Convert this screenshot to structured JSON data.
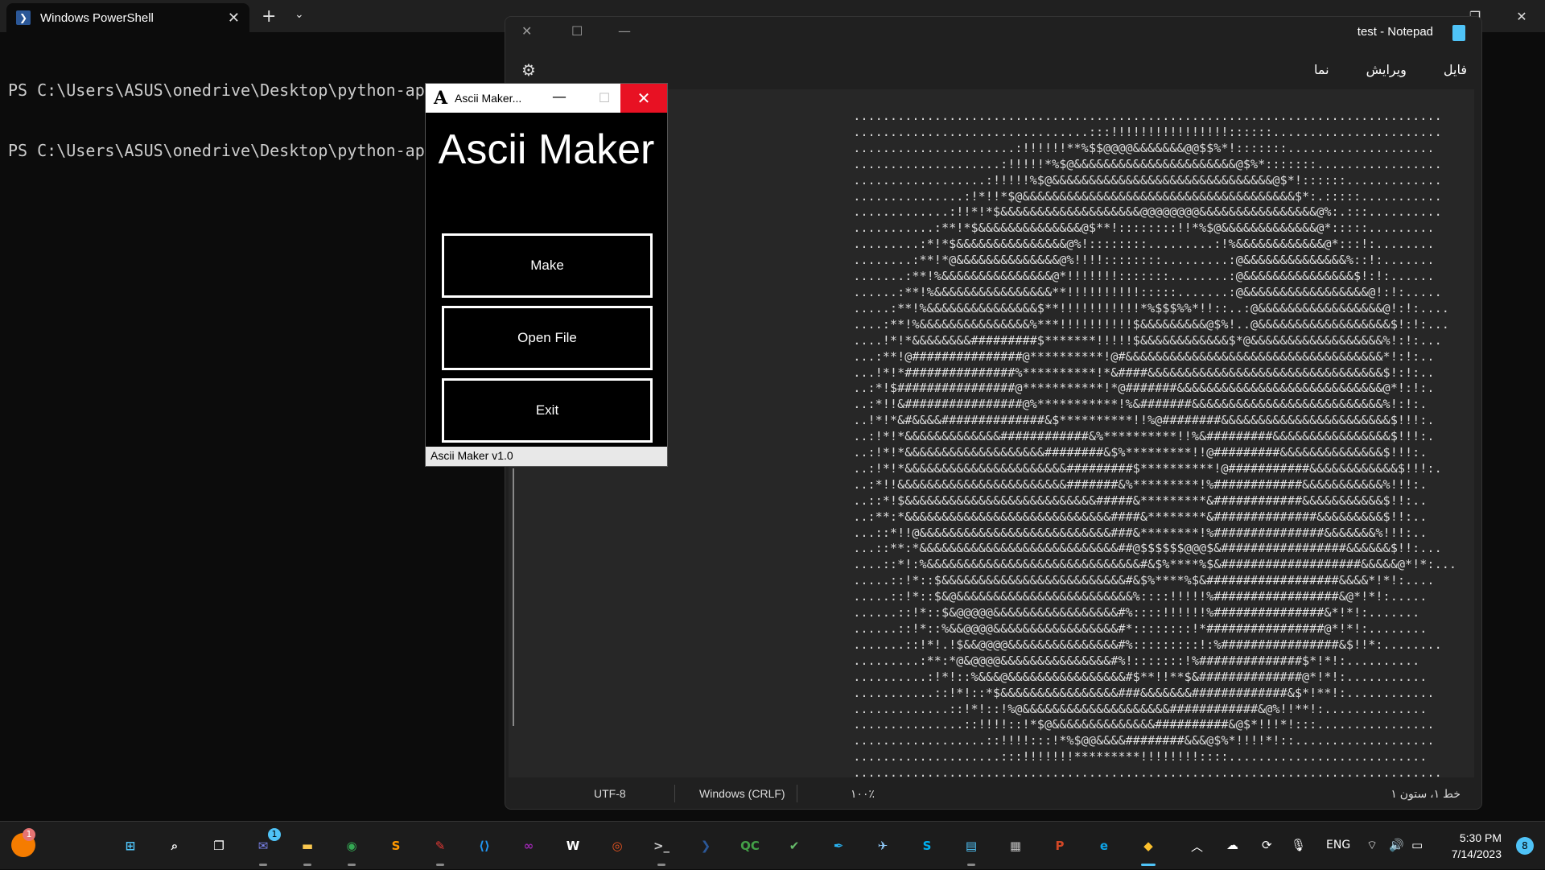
{
  "terminal": {
    "tab_title": "Windows PowerShell",
    "lines": [
      "PS C:\\Users\\ASUS\\onedrive\\Desktop\\python-app\\ascii-m",
      "PS C:\\Users\\ASUS\\onedrive\\Desktop\\python-app\\ascii-m"
    ]
  },
  "notepad": {
    "title": "test - Notepad",
    "menu": [
      "فایل",
      "ویرایش",
      "نما"
    ],
    "status": {
      "position": "خط ۱، ستون ۱",
      "zoom": "۱۰۰٪",
      "line_ending": "Windows (CRLF)",
      "encoding": "UTF-8"
    },
    "ascii_art": [
      "................................................................................",
      "................................:::!!!!!!!!!!!!!!!!::::::.......................",
      "......................:!!!!!!**%$$@@@@&&&&&&&@@$$%*!:::::::....................",
      "....................:!!!!!*%$@&&&&&&&&&&&&&&&&&&&&&&@$%*:::::::.................",
      "..................:!!!!!%$@&&&&&&&&&&&&&&&&&&&&&&&&&&&&&&@$*!::::::.............",
      "...............:!*!!*$@&&&&&&&&&&&&&&&&&&&&&&&&&&&&&&&&&&&&&$*:.:::::...........",
      ".............:!!*!*$&&&&&&&&&&&&&&&&&&&@@@@@@@@&&&&&&&&&&&&&&&&@%:.:::..........",
      "...........:**!*$&&&&&&&&&&&&&&@$**!::::::::!!*%$@&&&&&&&&&&&&&@*:::::.........",
      ".........:*!*$&&&&&&&&&&&&&&&@%!::::::::.........:!%&&&&&&&&&&&&@*:::!:........",
      "........:**!*@&&&&&&&&&&&&&&@%!!!!::::::::.........:@&&&&&&&&&&&&&&%::!:.......",
      ".......:**!%&&&&&&&&&&&&&&&@*!!!!!!!:::::::........:@&&&&&&&&&&&&&&&$!:!:......",
      "......:**!%&&&&&&&&&&&&&&&&**!!!!!!!!!!:::::.......:@&&&&&&&&&&&&&&&&&@!:!:.....",
      ".....:**!%&&&&&&&&&&&&&&&$**!!!!!!!!!!!*%$$$%%*!!::..:@&&&&&&&&&&&&&&&&&@!:!:....",
      "....:**!%&&&&&&&&&&&&&&&%***!!!!!!!!!!$&&&&&&&&&@$%!..@&&&&&&&&&&&&&&&&&&$!:!:...",
      "....!*!*&&&&&&&&#########$*******!!!!!$&&&&&&&&&&&&$*@&&&&&&&&&&&&&&&&&&%!:!:...",
      "...:**!@###############@**********!@#&&&&&&&&&&&&&&&&&&&&&&&&&&&&&&&&&&&*!:!:..",
      "...!*!*###############%**********!*&####&&&&&&&&&&&&&&&&&&&&&&&&&&&&&&&&$!:!:..",
      "..:*!$################@***********!*@#######&&&&&&&&&&&&&&&&&&&&&&&&&&&&@*!:!:.",
      "..:*!!&################@%***********!%&#######&&&&&&&&&&&&&&&&&&&&&&&&&&%!:!:.",
      "..!*!*&#&&&&##############&$**********!!%@########&&&&&&&&&&&&&&&&&&&&&&&$!!!:.",
      "..:!*!*&&&&&&&&&&&&&############&%**********!!%&#########&&&&&&&&&&&&&&&&$!!!:.",
      "..:!*!*&&&&&&&&&&&&&&&&&&&########&$%*********!!@#########&&&&&&&&&&&&&&$!!!:.",
      "..:!*!*&&&&&&&&&&&&&&&&&&&&&&#########$**********!@###########&&&&&&&&&&&&$!!!:.",
      "..:*!!&&&&&&&&&&&&&&&&&&&&&&&#######&%*********!%############&&&&&&&&&&&%!!!:.",
      "..::*!$&&&&&&&&&&&&&&&&&&&&&&&&&&#####&*********&############&&&&&&&&&&&$!!:..",
      "..:**:*&&&&&&&&&&&&&&&&&&&&&&&&&&&&####&********&##############&&&&&&&&&$!!:..",
      "...::*!!@&&&&&&&&&&&&&&&&&&&&&&&&&&###&********!%###############&&&&&&&%!!!:..",
      "...::**:*&&&&&&&&&&&&&&&&&&&&&&&&&&&##@$$$$$$@@@$&#################&&&&&&$!!:...",
      "....::*!:%&&&&&&&&&&&&&&&&&&&&&&&&&&&&&#&$%****%$&###################&&&&&@*!*:...",
      ".....::!*::$&&&&&&&&&&&&&&&&&&&&&&&&&#&$%****%$&##################&&&&*!*!:....",
      ".....::!*::$&@&&&&&&&&&&&&&&&&&&&&&&&&%::::!!!!!%#################&@*!*!:.....",
      "......::!*::$&@@@@@&&&&&&&&&&&&&&&&&#%::::!!!!!!%###############&*!*!:.......",
      "......::!*::%&&@@@@&&&&&&&&&&&&&&&&&#*::::::::!*################@*!*!:........",
      ".......::!*!.!$&&@@@@&&&&&&&&&&&&&&&#%:::::::::!:%################&$!!*:........",
      ".........:**:*@&@@@@&&&&&&&&&&&&&&&#%!:::::::!%##############$*!*!:..........",
      "..........:!*!::%&&&@&&&&&&&&&&&&&&&&#$**!!**$&##############@*!*!:...........",
      "...........::!*!::*$&&&&&&&&&&&&&&&&###&&&&&&&#############&$*!**!:............",
      ".............::!*!::!%@&&&&&&&&&&&&&&&&&&&&############&@%!!**!:..............",
      "...............::!!!!::!*$@&&&&&&&&&&&&&&##########&@$*!!!*!:::................",
      "..................::!!!!:::!*%$@@&&&&########&&&@$%*!!!!*!::...................",
      "....................:::!!!!!!!*********!!!!!!!!::::...........................",
      "................................................................................"
    ]
  },
  "ascii_maker": {
    "window_title": "Ascii Maker...",
    "heading": "Ascii Maker",
    "buttons": [
      "Make",
      "Open File",
      "Exit"
    ],
    "status": "Ascii Maker v1.0"
  },
  "taskbar": {
    "apps": [
      {
        "name": "windows-start-icon",
        "glyph": "⊞",
        "color": "#4fc3f7"
      },
      {
        "name": "search-icon",
        "glyph": "⌕",
        "color": "#ffffff"
      },
      {
        "name": "task-view-icon",
        "glyph": "❐",
        "color": "#ffffff"
      },
      {
        "name": "teams-chat-icon",
        "glyph": "✉",
        "color": "#7b83eb"
      },
      {
        "name": "file-explorer-icon",
        "glyph": "▬",
        "color": "#f9c74f"
      },
      {
        "name": "chrome-icon",
        "glyph": "◉",
        "color": "#34a853"
      },
      {
        "name": "sublime-text-icon",
        "glyph": "S",
        "color": "#ff9800"
      },
      {
        "name": "drawing-app-icon",
        "glyph": "✎",
        "color": "#e53935"
      },
      {
        "name": "vscode-icon",
        "glyph": "⟨⟩",
        "color": "#2196f3"
      },
      {
        "name": "visual-studio-icon",
        "glyph": "∞",
        "color": "#9c27b0"
      },
      {
        "name": "word-app-icon",
        "glyph": "W",
        "color": "#ffffff"
      },
      {
        "name": "ubuntu-icon",
        "glyph": "◎",
        "color": "#e95420"
      },
      {
        "name": "terminal-icon",
        "glyph": ">_",
        "color": "#cccccc"
      },
      {
        "name": "powershell-icon",
        "glyph": "❯",
        "color": "#2b5797"
      },
      {
        "name": "qc-app-icon",
        "glyph": "QC",
        "color": "#43a047"
      },
      {
        "name": "graph-app-icon",
        "glyph": "✔",
        "color": "#66bb6a"
      },
      {
        "name": "pen-app-icon",
        "glyph": "✒",
        "color": "#29b6f6"
      },
      {
        "name": "bird-app-icon",
        "glyph": "✈",
        "color": "#90caf9"
      },
      {
        "name": "skype-icon",
        "glyph": "S",
        "color": "#00aff0"
      },
      {
        "name": "notepad-icon",
        "glyph": "▤",
        "color": "#4fc3f7"
      },
      {
        "name": "database-icon",
        "glyph": "▦",
        "color": "#bdbdbd"
      },
      {
        "name": "powerpoint-icon",
        "glyph": "P",
        "color": "#d24726"
      },
      {
        "name": "edge-icon",
        "glyph": "e",
        "color": "#0ea5e9"
      },
      {
        "name": "python-icon",
        "glyph": "◆",
        "color": "#fbc02d"
      }
    ],
    "tray": {
      "language": "ENG",
      "time": "5:30 PM",
      "date": "7/14/2023",
      "notification_count": "8",
      "badge_teams": "1",
      "badge_left": "1"
    }
  }
}
